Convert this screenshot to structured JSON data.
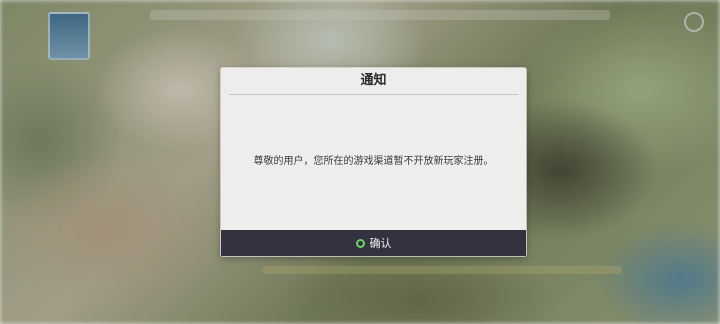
{
  "dialog": {
    "title": "通知",
    "message": "尊敬的用户，您所在的游戏渠道暂不开放新玩家注册。",
    "confirm_label": "确认",
    "confirm_icon": "circle-icon",
    "accent": "#6fd163"
  }
}
